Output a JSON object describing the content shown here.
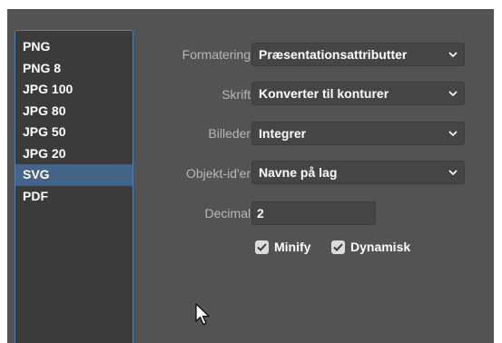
{
  "formats": [
    "PNG",
    "PNG 8",
    "JPG 100",
    "JPG 80",
    "JPG 50",
    "JPG 20",
    "SVG",
    "PDF"
  ],
  "selected_format": "SVG",
  "options": {
    "formatting": {
      "label": "Formatering:",
      "value": "Præsentationsattributter"
    },
    "font": {
      "label": "Skrift:",
      "value": "Konverter til konturer"
    },
    "images": {
      "label": "Billeder:",
      "value": "Integrer"
    },
    "object_ids": {
      "label": "Objekt-id'er:",
      "value": "Navne på lag"
    },
    "decimal": {
      "label": "Decimal:",
      "value": "2"
    }
  },
  "checkboxes": {
    "minify": {
      "label": "Minify",
      "checked": true
    },
    "responsive": {
      "label": "Dynamisk",
      "checked": true
    }
  },
  "colors": {
    "panel": "#535353",
    "list_bg": "#3b3b3b",
    "selection": "#446487",
    "focus_border": "#4a7fb8"
  }
}
